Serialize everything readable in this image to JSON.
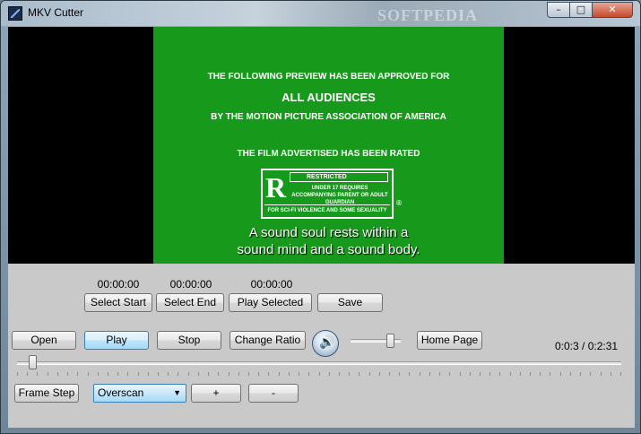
{
  "window": {
    "title": "MKV Cutter",
    "watermark": "SOFTPEDIA",
    "min_glyph": "–",
    "max_glyph": "□",
    "close_glyph": "✕"
  },
  "video": {
    "lines": [
      "THE FOLLOWING PREVIEW HAS BEEN APPROVED FOR",
      "ALL AUDIENCES",
      "BY THE MOTION PICTURE ASSOCIATION OF AMERICA",
      "THE FILM ADVERTISED HAS BEEN RATED"
    ],
    "rating_letter": "R",
    "rating_title": "RESTRICTED",
    "rating_desc": "UNDER 17 REQUIRES ACCOMPANYING PARENT OR ADULT GUARDIAN",
    "rating_reason": "FOR SCI-FI VIOLENCE AND SOME SEXUALITY",
    "registered": "®",
    "subtitle_1": "A sound soul rests within a",
    "subtitle_2": "sound mind and a sound body.",
    "colors": {
      "screen": "#17991b",
      "letterbox": "#000000"
    }
  },
  "cut": {
    "start_time": "00:00:00",
    "end_time": "00:00:00",
    "selected_time": "00:00:00",
    "select_start_label": "Select Start",
    "select_end_label": "Select End",
    "play_selected_label": "Play Selected",
    "save_label": "Save"
  },
  "controls": {
    "open_label": "Open",
    "play_label": "Play",
    "stop_label": "Stop",
    "change_ratio_label": "Change Ratio",
    "volume_glyph": "🔊",
    "volume_level": 0.85,
    "home_page_label": "Home Page",
    "position_text": "0:0:3 / 0:2:31",
    "seek_fraction": 0.02
  },
  "bottom": {
    "frame_step_label": "Frame Step",
    "mode_selected": "Overscan",
    "plus_label": "+",
    "minus_label": "-",
    "dropdown_glyph": "▼"
  }
}
